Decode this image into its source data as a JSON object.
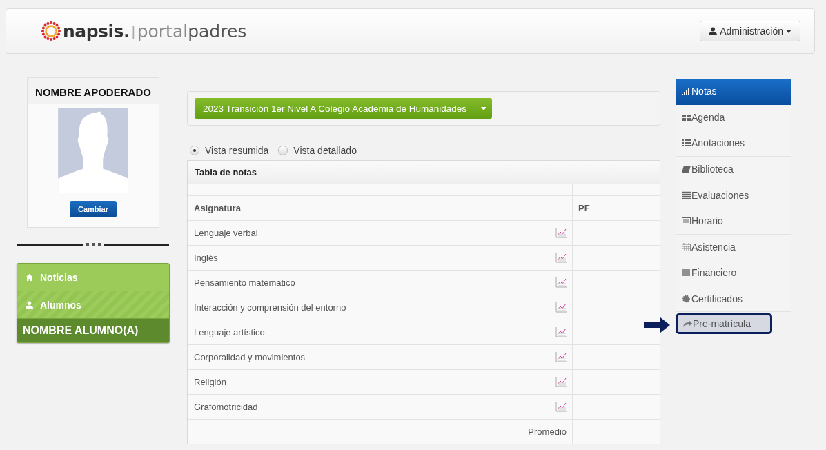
{
  "header": {
    "logo": [
      "napsis.",
      "|",
      "portal",
      "padres"
    ],
    "user_menu": "Administración"
  },
  "profile": {
    "title": "NOMBRE APODERADO",
    "button": "Cambiar"
  },
  "left_nav": [
    {
      "label": "Noticias",
      "kind": "link"
    },
    {
      "label": "Alumnos",
      "kind": "link"
    },
    {
      "label": "NOMBRE ALUMNO(A)",
      "kind": "header"
    }
  ],
  "course_selector": "2023 Transición 1er Nivel A Colegio Academia de Humanidades",
  "view_options": [
    {
      "label": "Vista resumida",
      "selected": true
    },
    {
      "label": "Vista detallado",
      "selected": false
    }
  ],
  "table": {
    "title": "Tabla de notas",
    "columns": [
      "Asignatura",
      "PF"
    ],
    "rows": [
      {
        "subject": "Lenguaje verbal"
      },
      {
        "subject": "Inglés"
      },
      {
        "subject": "Pensamiento matematico"
      },
      {
        "subject": "Interacción y comprensión del entorno"
      },
      {
        "subject": "Lenguaje artístico"
      },
      {
        "subject": "Corporalidad y movimientos"
      },
      {
        "subject": "Religión"
      },
      {
        "subject": "Grafomotricidad"
      }
    ],
    "footer": "Promedio"
  },
  "side_menu": [
    {
      "label": "Notas",
      "selected": true,
      "highlighted": false
    },
    {
      "label": "Agenda",
      "selected": false,
      "highlighted": false
    },
    {
      "label": "Anotaciones",
      "selected": false,
      "highlighted": false
    },
    {
      "label": "Biblioteca",
      "selected": false,
      "highlighted": false
    },
    {
      "label": "Evaluaciones",
      "selected": false,
      "highlighted": false
    },
    {
      "label": "Horario",
      "selected": false,
      "highlighted": false
    },
    {
      "label": "Asistencia",
      "selected": false,
      "highlighted": false
    },
    {
      "label": "Financiero",
      "selected": false,
      "highlighted": false
    },
    {
      "label": "Certificados",
      "selected": false,
      "highlighted": false
    },
    {
      "label": "Pre-matrícula",
      "selected": false,
      "highlighted": true
    }
  ]
}
